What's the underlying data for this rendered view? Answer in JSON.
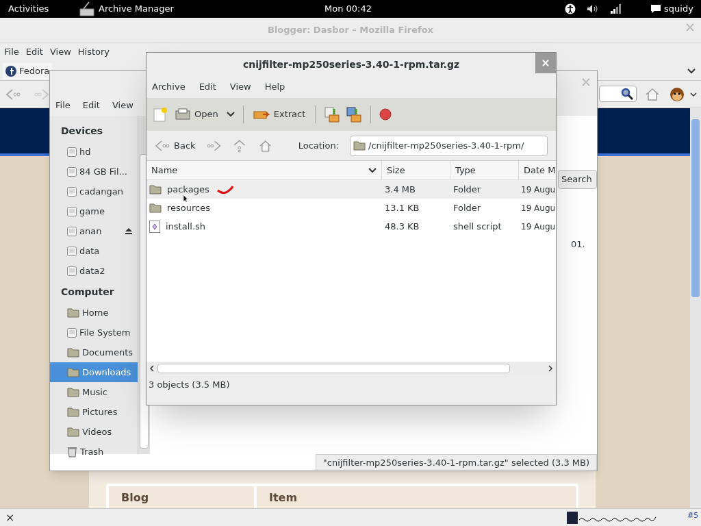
{
  "top_bar": {
    "activities": "Activities",
    "app": "Archive Manager",
    "clock": "Mon 00:42",
    "user": "squidy"
  },
  "firefox": {
    "title": "Blogger: Dasbor – Mozilla Firefox",
    "menu": [
      "File",
      "Edit",
      "View",
      "History"
    ],
    "tab": "Fedora",
    "table_columns": [
      "Blog",
      "Item"
    ],
    "status_bar": {
      "close": "×",
      "count": "#5"
    }
  },
  "file_manager": {
    "menu": [
      "File",
      "Edit",
      "View"
    ],
    "sidebar": [
      {
        "heading": "Devices",
        "items": [
          {
            "label": "hd",
            "kind": "drive",
            "selected": false,
            "eject": false
          },
          {
            "label": "84 GB Fil...",
            "kind": "drive",
            "selected": false,
            "eject": false
          },
          {
            "label": "cadangan",
            "kind": "drive",
            "selected": false,
            "eject": false
          },
          {
            "label": "game",
            "kind": "drive",
            "selected": false,
            "eject": false
          },
          {
            "label": "anan",
            "kind": "drive",
            "selected": false,
            "eject": true
          },
          {
            "label": "data",
            "kind": "drive",
            "selected": false,
            "eject": false
          },
          {
            "label": "data2",
            "kind": "drive",
            "selected": false,
            "eject": false
          }
        ]
      },
      {
        "heading": "Computer",
        "items": [
          {
            "label": "Home",
            "kind": "folder",
            "selected": false,
            "eject": false
          },
          {
            "label": "File System",
            "kind": "drive",
            "selected": false,
            "eject": false
          },
          {
            "label": "Documents",
            "kind": "folder",
            "selected": false,
            "eject": false
          },
          {
            "label": "Downloads",
            "kind": "folder",
            "selected": true,
            "eject": false
          },
          {
            "label": "Music",
            "kind": "folder",
            "selected": false,
            "eject": false
          },
          {
            "label": "Pictures",
            "kind": "folder",
            "selected": false,
            "eject": false
          },
          {
            "label": "Videos",
            "kind": "folder",
            "selected": false,
            "eject": false
          },
          {
            "label": "Trash",
            "kind": "trash",
            "selected": false,
            "eject": false
          }
        ]
      }
    ],
    "search_button": "Search",
    "partial_text": "01.",
    "status": "\"cnijfilter-mp250series-3.40-1-rpm.tar.gz\" selected (3.3 MB)"
  },
  "archive": {
    "title": "cnijfilter-mp250series-3.40-1-rpm.tar.gz",
    "menu": [
      "Archive",
      "Edit",
      "View",
      "Help"
    ],
    "toolbar": {
      "open": "Open",
      "extract": "Extract"
    },
    "nav": {
      "back": "Back",
      "location_label": "Location:",
      "location": "/cnijfilter-mp250series-3.40-1-rpm/"
    },
    "columns": [
      "Name",
      "Size",
      "Type",
      "Date M"
    ],
    "rows": [
      {
        "name": "packages",
        "size": "3.4 MB",
        "type": "Folder",
        "date": "19 Augu",
        "kind": "folder",
        "highlighted": true
      },
      {
        "name": "resources",
        "size": "13.1 KB",
        "type": "Folder",
        "date": "19 Augu",
        "kind": "folder",
        "highlighted": false
      },
      {
        "name": "install.sh",
        "size": "48.3 KB",
        "type": "shell script",
        "date": "19 Augu",
        "kind": "script",
        "highlighted": false
      }
    ],
    "status": "3 objects (3.5 MB)"
  }
}
